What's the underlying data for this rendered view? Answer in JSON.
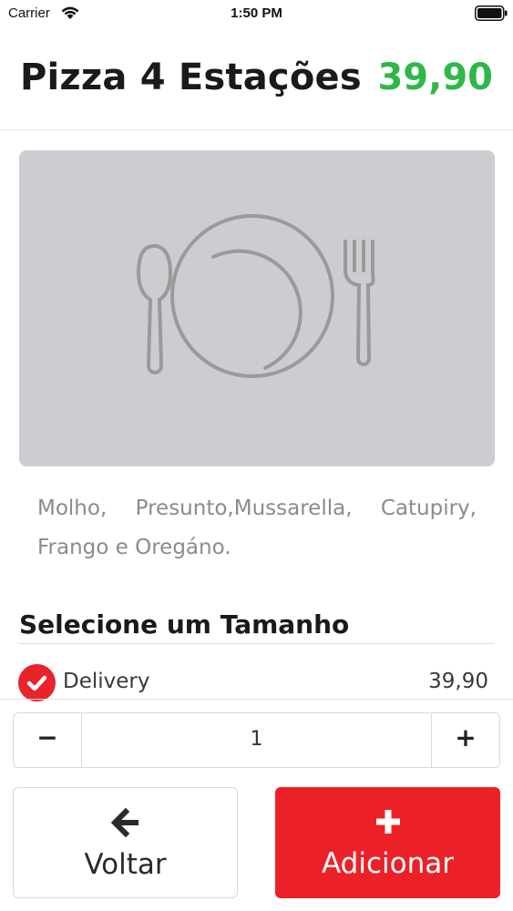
{
  "status_bar": {
    "carrier": "Carrier",
    "time": "1:50 PM"
  },
  "product": {
    "name": "Pizza 4 Estações",
    "price": "39,90",
    "price_color": "#2fb84a",
    "image_icon": "plate-utensils-placeholder-icon",
    "description": "Molho, Presunto,Mussarella, Catupiry, Frango e Oregáno."
  },
  "size_section": {
    "title": "Selecione um Tamanho",
    "options": [
      {
        "label": "Delivery",
        "price": "39,90",
        "selected": true
      }
    ]
  },
  "quantity": {
    "minus_label": "−",
    "value": "1",
    "plus_label": "+"
  },
  "actions": {
    "back_label": "Voltar",
    "back_icon": "arrow-left-icon",
    "add_label": "Adicionar",
    "add_icon": "plus-icon",
    "add_color": "#ec2127"
  }
}
